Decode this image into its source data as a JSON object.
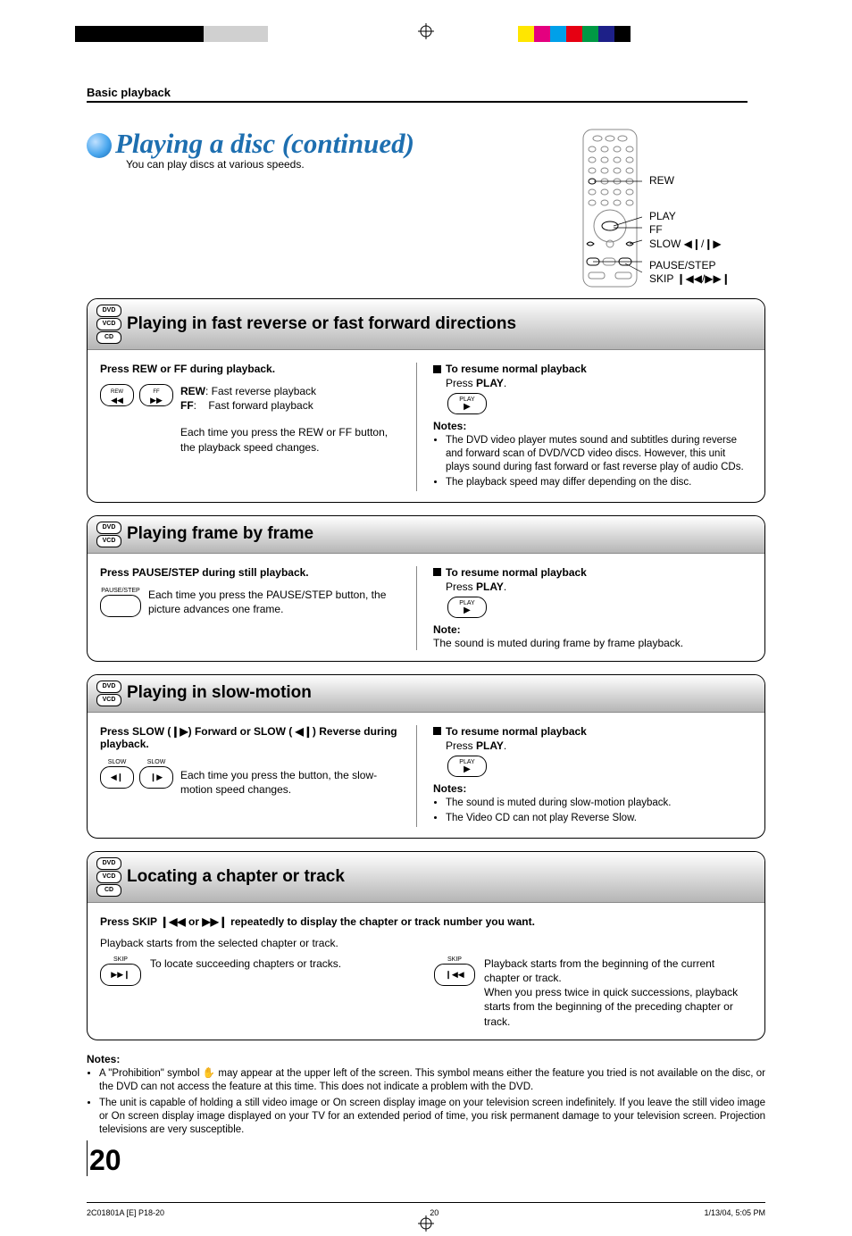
{
  "header": {
    "section_label": "Basic playback",
    "title": "Playing a disc (continued)",
    "subtitle": "You can play discs at various speeds."
  },
  "remote": {
    "labels": [
      "REW",
      "PLAY",
      "FF",
      "SLOW ◀❙/❙▶",
      "PAUSE/STEP",
      "SKIP ❙◀◀/▶▶❙"
    ]
  },
  "sections": [
    {
      "discs": [
        "DVD",
        "VCD",
        "CD"
      ],
      "title": "Playing in fast reverse or fast forward directions",
      "left": {
        "instruction": "Press REW or FF during playback.",
        "buttons": [
          {
            "top": "REW",
            "sym": "◀◀"
          },
          {
            "top": "FF",
            "sym": "▶▶"
          }
        ],
        "desc1": "REW: Fast reverse playback",
        "desc1b": "FF:     Fast forward playback",
        "desc2": "Each time you press the REW or FF button, the playback speed changes."
      },
      "right": {
        "resume_title": "To resume normal playback",
        "resume_text": "Press PLAY.",
        "play_label": "PLAY",
        "notes_label": "Notes:",
        "notes": [
          "The DVD video player mutes sound and subtitles during reverse and forward scan of DVD/VCD video discs. However, this unit plays sound during fast forward or fast reverse play of audio CDs.",
          "The playback speed may differ depending on the disc."
        ]
      }
    },
    {
      "discs": [
        "DVD",
        "VCD"
      ],
      "title": "Playing frame by frame",
      "left": {
        "instruction": "Press PAUSE/STEP during still playback.",
        "button_label": "PAUSE/STEP",
        "desc": "Each time you press the PAUSE/STEP button, the picture advances one frame."
      },
      "right": {
        "resume_title": "To resume normal playback",
        "resume_text": "Press PLAY.",
        "play_label": "PLAY",
        "note_label": "Note:",
        "note": "The sound is muted during frame by frame playback."
      }
    },
    {
      "discs": [
        "DVD",
        "VCD"
      ],
      "title": "Playing in slow-motion",
      "left": {
        "instruction": "Press SLOW (❙▶) Forward or SLOW ( ◀❙) Reverse during playback.",
        "buttons": [
          {
            "top": "SLOW",
            "sym": "◀❙"
          },
          {
            "top": "SLOW",
            "sym": "❙▶"
          }
        ],
        "desc": "Each time you press the button, the slow-motion speed changes."
      },
      "right": {
        "resume_title": "To resume normal playback",
        "resume_text": "Press PLAY.",
        "play_label": "PLAY",
        "notes_label": "Notes:",
        "notes": [
          "The sound is muted during slow-motion playback.",
          "The Video CD can not play Reverse Slow."
        ]
      }
    },
    {
      "discs": [
        "DVD",
        "VCD",
        "CD"
      ],
      "title": "Locating a chapter or track",
      "wide": {
        "instruction": "Press SKIP ❙◀◀ or ▶▶❙ repeatedly to display the chapter or track number you want.",
        "sub": "Playback starts from the selected chapter or track.",
        "skip_next": {
          "label": "SKIP",
          "sym": "▶▶❙"
        },
        "skip_next_desc": "To locate succeeding chapters or tracks.",
        "skip_prev": {
          "label": "SKIP",
          "sym": "❙◀◀"
        },
        "skip_prev_desc": "Playback starts from the beginning of the current chapter or track.\nWhen you press twice in quick successions, playback starts from the beginning of the preceding chapter or track."
      }
    }
  ],
  "bottom_notes": {
    "label": "Notes:",
    "items": [
      "A \"Prohibition\" symbol ✋ may appear at the upper left of the screen. This symbol means either the feature you tried is not available on the disc, or the DVD can not access the feature at this time. This does not indicate a problem with the DVD.",
      "The unit is capable of holding a still video image or On screen display image on your television screen indefinitely.  If you leave the still video image or On screen display image displayed on your TV for an extended period of time, you risk permanent damage to your television screen.  Projection televisions are very susceptible."
    ]
  },
  "page_number": "20",
  "footer": {
    "left": "2C01801A [E] P18-20",
    "center": "20",
    "right": "1/13/04, 5:05 PM"
  }
}
